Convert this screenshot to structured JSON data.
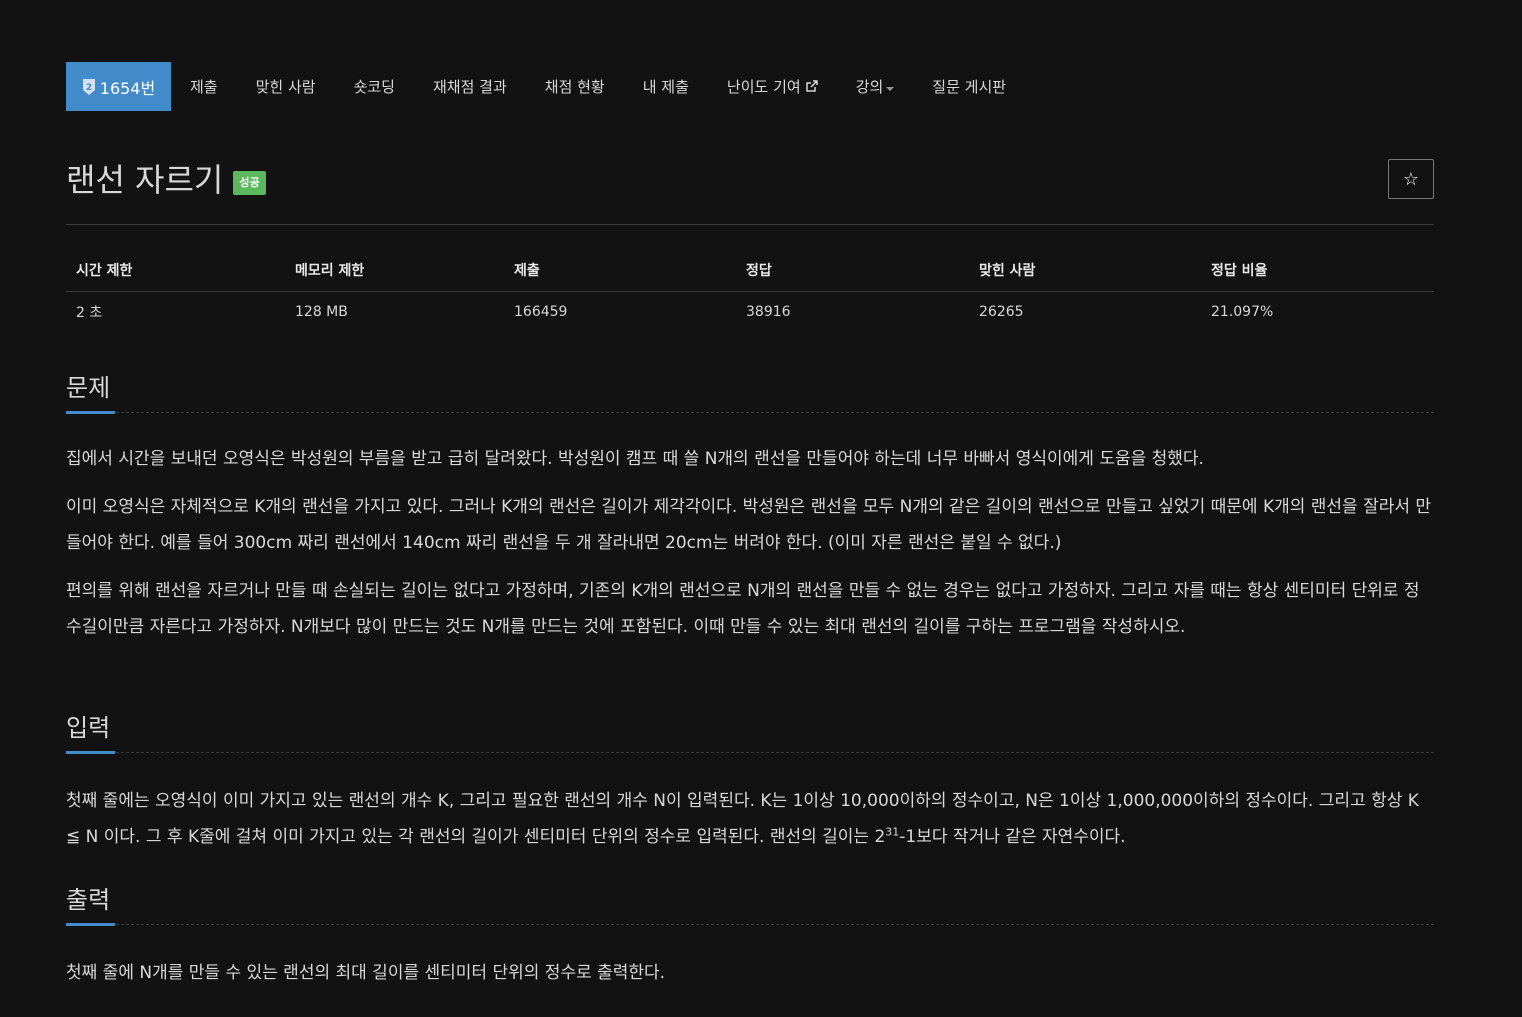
{
  "nav": {
    "problem_no": "1654번",
    "items": [
      "제출",
      "맞힌 사람",
      "숏코딩",
      "재채점 결과",
      "채점 현황",
      "내 제출",
      "난이도 기여",
      "강의",
      "질문 게시판"
    ]
  },
  "problem": {
    "title": "랜선 자르기",
    "status_badge": "성공",
    "star": "☆"
  },
  "stats": {
    "headers": [
      "시간 제한",
      "메모리 제한",
      "제출",
      "정답",
      "맞힌 사람",
      "정답 비율"
    ],
    "values": [
      "2 초",
      "128 MB",
      "166459",
      "38916",
      "26265",
      "21.097%"
    ]
  },
  "sections": {
    "problem_title": "문제",
    "problem_paras": [
      "집에서 시간을 보내던 오영식은 박성원의 부름을 받고 급히 달려왔다. 박성원이 캠프 때 쓸 N개의 랜선을 만들어야 하는데 너무 바빠서 영식이에게 도움을 청했다.",
      "이미 오영식은 자체적으로 K개의 랜선을 가지고 있다. 그러나 K개의 랜선은 길이가 제각각이다. 박성원은 랜선을 모두 N개의 같은 길이의 랜선으로 만들고 싶었기 때문에 K개의 랜선을 잘라서 만들어야 한다. 예를 들어 300cm 짜리 랜선에서 140cm 짜리 랜선을 두 개 잘라내면 20cm는 버려야 한다. (이미 자른 랜선은 붙일 수 없다.)",
      "편의를 위해 랜선을 자르거나 만들 때 손실되는 길이는 없다고 가정하며, 기존의 K개의 랜선으로 N개의 랜선을 만들 수 없는 경우는 없다고 가정하자. 그리고 자를 때는 항상 센티미터 단위로 정수길이만큼 자른다고 가정하자. N개보다 많이 만드는 것도 N개를 만드는 것에 포함된다. 이때 만들 수 있는 최대 랜선의 길이를 구하는 프로그램을 작성하시오."
    ],
    "input_title": "입력",
    "input_text_a": "첫째 줄에는 오영식이 이미 가지고 있는 랜선의 개수 K, 그리고 필요한 랜선의 개수 N이 입력된다. K는 1이상 10,000이하의 정수이고, N은 1이상 1,000,000이하의 정수이다. 그리고 항상 K ≦ N 이다. 그 후 K줄에 걸쳐 이미 가지고 있는 각 랜선의 길이가 센티미터 단위의 정수로 입력된다. 랜선의 길이는 2",
    "input_sup": "31",
    "input_text_b": "-1보다 작거나 같은 자연수이다.",
    "output_title": "출력",
    "output_text": "첫째 줄에 N개를 만들 수 있는 랜선의 최대 길이를 센티미터 단위의 정수로 출력한다."
  }
}
